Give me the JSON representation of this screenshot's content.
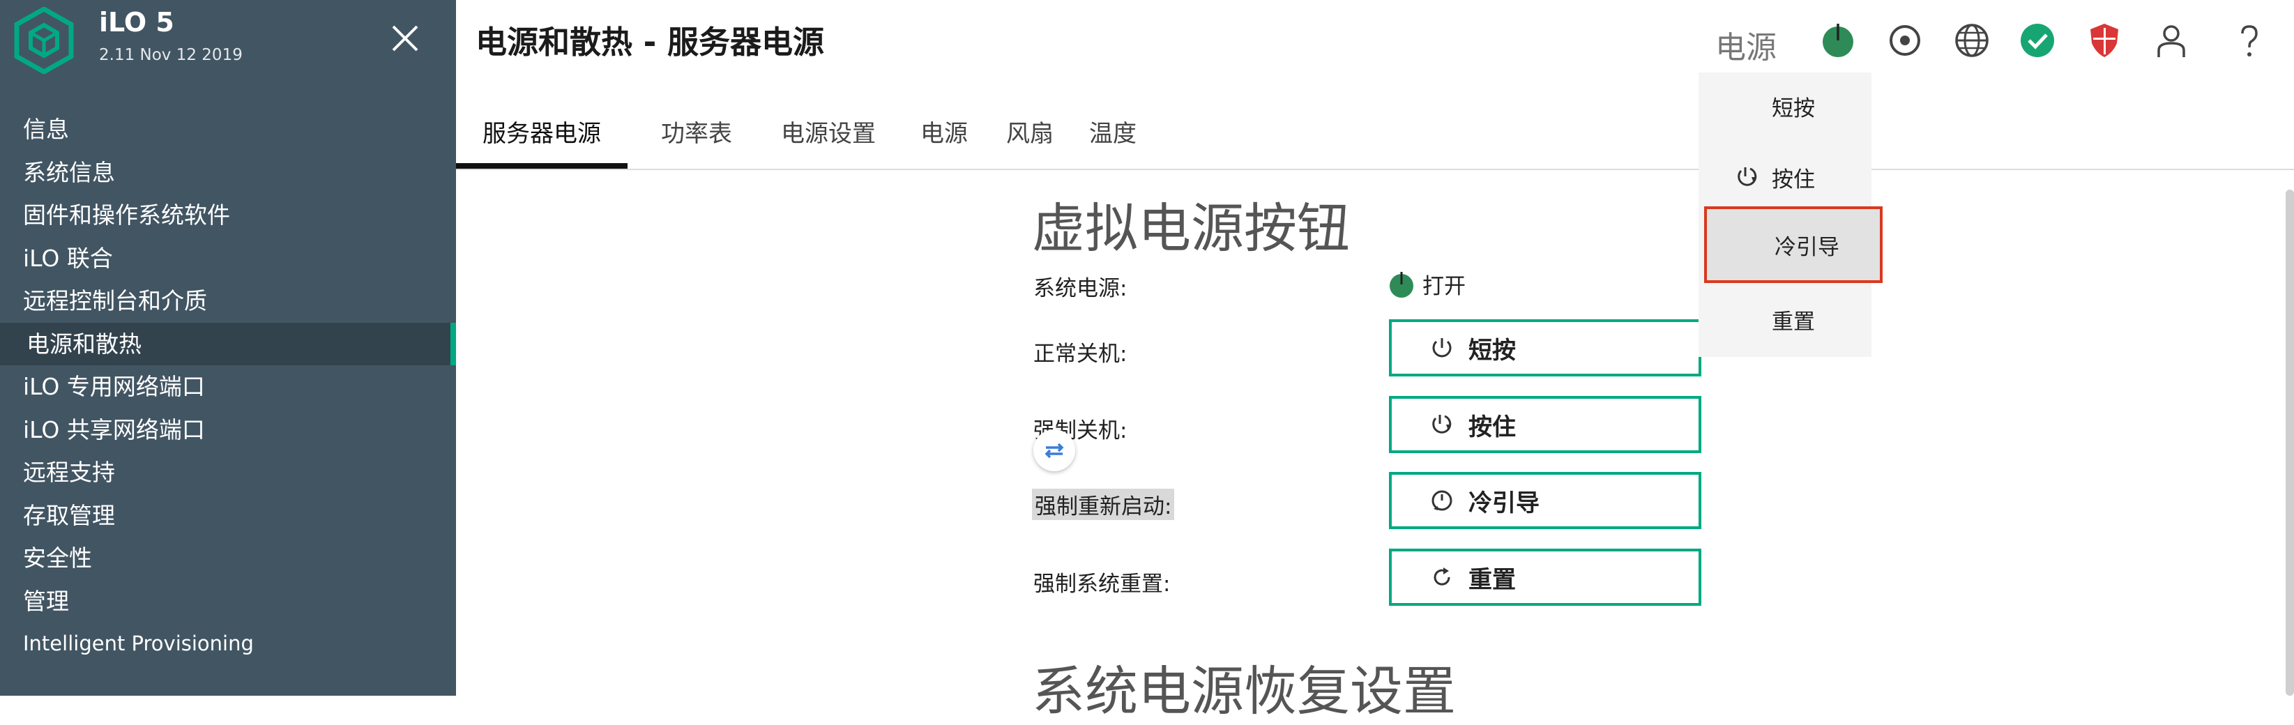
{
  "brand": {
    "title": "iLO 5",
    "subtitle": "2.11 Nov 12 2019"
  },
  "sidebar": {
    "items": [
      {
        "label": "信息"
      },
      {
        "label": "系统信息"
      },
      {
        "label": "固件和操作系统软件"
      },
      {
        "label": "iLO 联合"
      },
      {
        "label": "远程控制台和介质"
      },
      {
        "label": "电源和散热",
        "active": true
      },
      {
        "label": "iLO 专用网络端口"
      },
      {
        "label": "iLO 共享网络端口"
      },
      {
        "label": "远程支持"
      },
      {
        "label": "存取管理"
      },
      {
        "label": "安全性"
      },
      {
        "label": "管理"
      },
      {
        "label": "Intelligent Provisioning"
      }
    ]
  },
  "page": {
    "title": "电源和散热 - 服务器电源"
  },
  "tabs": [
    {
      "label": "服务器电源",
      "active": true
    },
    {
      "label": "功率表"
    },
    {
      "label": "电源设置"
    },
    {
      "label": "电源"
    },
    {
      "label": "风扇"
    },
    {
      "label": "温度"
    }
  ],
  "main": {
    "section_title": "虚拟电源按钮",
    "section_title2": "系统电源恢复设置",
    "system_power_label": "系统电源:",
    "system_power_state": "打开",
    "rows": [
      {
        "label": "正常关机:",
        "button": "短按",
        "icon": "power-icon"
      },
      {
        "label": "强制关机:",
        "button": "按住",
        "icon": "power-hold-icon"
      },
      {
        "label": "强制重新启动:",
        "button": "冷引导",
        "icon": "cold-boot-icon"
      },
      {
        "label": "强制系统重置:",
        "button": "重置",
        "icon": "reset-icon"
      }
    ]
  },
  "header": {
    "power_label": "电源",
    "icons": [
      "power-status-icon",
      "location-icon",
      "globe-icon",
      "health-ok-icon",
      "security-shield-icon",
      "user-icon",
      "help-icon"
    ]
  },
  "dropdown": {
    "items": [
      {
        "label": "短按"
      },
      {
        "label": "按住",
        "icon": "power-hold-icon"
      },
      {
        "label": "冷引导",
        "selected": true
      },
      {
        "label": "重置"
      }
    ]
  },
  "colors": {
    "accent": "#01a982",
    "sidebar": "#425563",
    "highlight": "#d9391f"
  }
}
